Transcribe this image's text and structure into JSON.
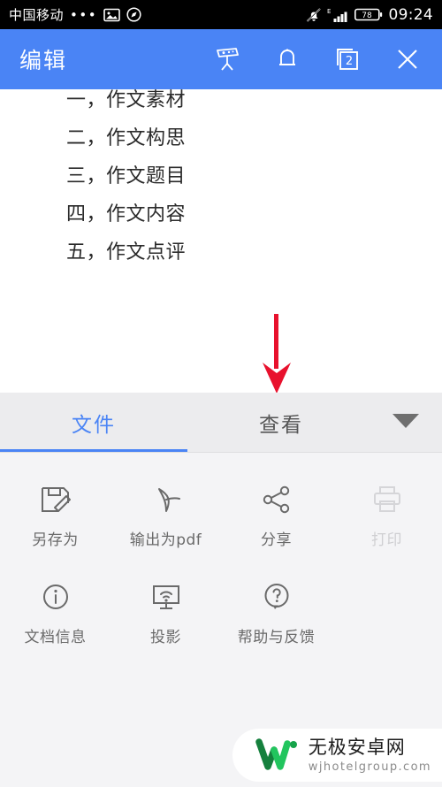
{
  "status_bar": {
    "carrier": "中国移动",
    "dots": "•••",
    "icons": [
      "photo-icon",
      "compass-icon",
      "bell-muted-icon",
      "signal-bars-icon"
    ],
    "network_type": "E",
    "battery_level": "78",
    "time": "09:24"
  },
  "toolbar": {
    "title": "编辑",
    "background_color": "#4a84f5",
    "actions": [
      {
        "name": "projector-icon",
        "label": "投影"
      },
      {
        "name": "bell-icon",
        "label": "提醒"
      },
      {
        "name": "documents-icon",
        "label": "文档",
        "badge": "2"
      },
      {
        "name": "close-icon",
        "label": "关闭"
      }
    ]
  },
  "document": {
    "lines": [
      "一，作文素材",
      "二，作文构思",
      "三，作文题目",
      "四，作文内容",
      "五，作文点评"
    ]
  },
  "annotation": {
    "type": "arrow-down",
    "color": "#e8112d",
    "points_at": "查看"
  },
  "panel": {
    "tabs": [
      {
        "label": "文件",
        "active": true
      },
      {
        "label": "查看",
        "active": false
      }
    ],
    "expand_icon": "chevron-down-icon",
    "accent_color": "#4a84f5",
    "rows": [
      [
        {
          "label": "另存为",
          "icon": "save-as-icon",
          "disabled": false
        },
        {
          "label": "输出为pdf",
          "icon": "export-pdf-icon",
          "disabled": false
        },
        {
          "label": "分享",
          "icon": "share-icon",
          "disabled": false
        },
        {
          "label": "打印",
          "icon": "print-icon",
          "disabled": true
        }
      ],
      [
        {
          "label": "文档信息",
          "icon": "info-icon",
          "disabled": false
        },
        {
          "label": "投影",
          "icon": "cast-icon",
          "disabled": false
        },
        {
          "label": "帮助与反馈",
          "icon": "help-icon",
          "disabled": false
        }
      ]
    ]
  },
  "watermark": {
    "site_name": "无极安卓网",
    "url": "wjhotelgroup.com",
    "logo_color": "#16a34a"
  }
}
